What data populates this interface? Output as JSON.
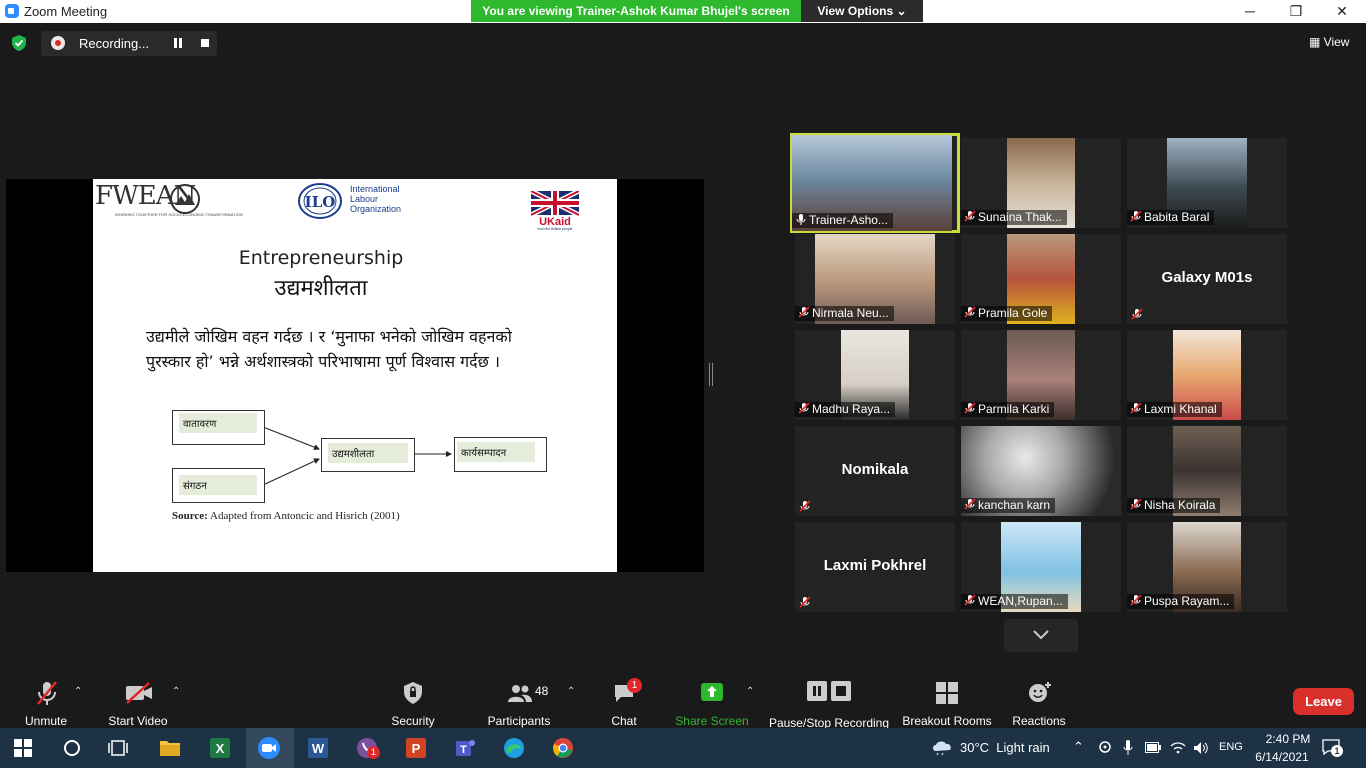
{
  "window": {
    "title": "Zoom Meeting",
    "viewing_banner": "You are viewing Trainer-Ashok Kumar Bhujel's screen",
    "view_options": "View Options",
    "minimize": "─",
    "restore": "❐",
    "close": "✕"
  },
  "meeting_bar": {
    "recording_status": "Recording...",
    "view_label": "View"
  },
  "slide": {
    "org_logo_text": "FWEAN",
    "org_logo_tagline": "WORKING TOGETHER FOR SOCIO-ECONOMIC TRANSFORMATION",
    "ilo_text_line1": "International",
    "ilo_text_line2": "Labour",
    "ilo_text_line3": "Organization",
    "ukaid_text": "UKaid",
    "ukaid_subtext": "from the British people",
    "title_en": "Entrepreneurship",
    "title_ne": "उद्यमशीलता",
    "body_line1": "उद्यमीले जोखिम वहन गर्दछ । र ‘मुनाफा भनेको जोखिम वहनको",
    "body_line2": "पुरस्कार हो’ भन्ने अर्थशास्त्रको परिभाषामा पूर्ण विश्वास गर्दछ ।",
    "diagram": {
      "environment": "वातावरण",
      "organization": "संगठन",
      "entrepreneurship": "उद्यमशीलता",
      "performance": "कार्यसम्पादन"
    },
    "source_label": "Source:",
    "source_text": "Adapted from Antoncic and Hisrich (2001)"
  },
  "gallery": [
    {
      "name": "Trainer-Asho...",
      "active": true,
      "muted": false
    },
    {
      "name": "Sunaina Thak...",
      "muted": true
    },
    {
      "name": "Babita Baral",
      "muted": true
    },
    {
      "name": "Nirmala Neu...",
      "muted": true
    },
    {
      "name": "Pramila Gole",
      "muted": true
    },
    {
      "name": "Galaxy M01s",
      "muted": true,
      "video_off": true
    },
    {
      "name": "Madhu Raya...",
      "muted": true
    },
    {
      "name": "Parmila Karki",
      "muted": true
    },
    {
      "name": "Laxmi Khanal",
      "muted": true
    },
    {
      "name": "Nomikala",
      "muted": true,
      "video_off": true
    },
    {
      "name": "kanchan karn",
      "muted": true
    },
    {
      "name": "Nisha Koirala",
      "muted": true
    },
    {
      "name": "Laxmi Pokhrel",
      "muted": true,
      "video_off": true
    },
    {
      "name": "WEAN,Rupan...",
      "muted": true
    },
    {
      "name": "Puspa Rayam...",
      "muted": true
    }
  ],
  "toolbar": {
    "unmute": "Unmute",
    "start_video": "Start Video",
    "security": "Security",
    "participants": "Participants",
    "participant_count": "48",
    "chat": "Chat",
    "chat_badge": "1",
    "share_screen": "Share Screen",
    "pause_stop_recording": "Pause/Stop Recording",
    "breakout_rooms": "Breakout Rooms",
    "reactions": "Reactions",
    "leave": "Leave"
  },
  "taskbar": {
    "viber_badge": "1",
    "weather": "30°C  Light rain",
    "language": "ENG",
    "time": "2:40 PM",
    "date": "6/14/2021",
    "notification_count": "1"
  },
  "colors": {
    "banner_green": "#2eb82e",
    "share_green": "#2eb82e",
    "leave_red": "#d9302c",
    "active_speaker": "#c8dd3a",
    "taskbar": "#1e3246"
  }
}
